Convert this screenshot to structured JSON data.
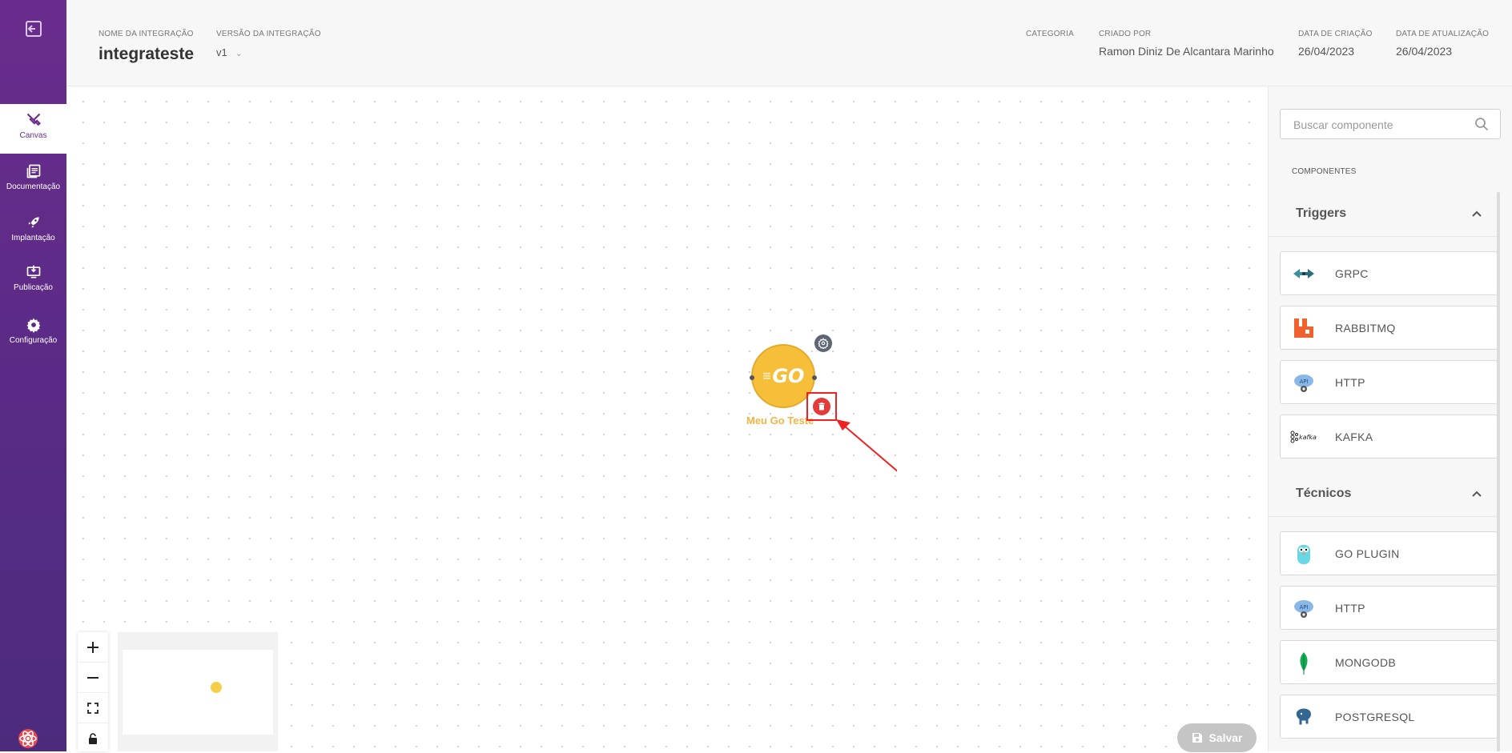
{
  "header": {
    "integration_name_label": "NOME DA INTEGRAÇÃO",
    "integration_name": "integrateste",
    "version_label": "VERSÃO DA INTEGRAÇÃO",
    "version": "v1",
    "category_label": "CATEGORIA",
    "category": "",
    "created_by_label": "CRIADO POR",
    "created_by": "Ramon Diniz De Alcantara Marinho",
    "created_date_label": "DATA DE CRIAÇÃO",
    "created_date": "26/04/2023",
    "updated_date_label": "DATA DE ATUALIZAÇÃO",
    "updated_date": "26/04/2023"
  },
  "sidebar": {
    "items": [
      {
        "label": "Canvas",
        "icon": "tools-icon",
        "active": true
      },
      {
        "label": "Documentação",
        "icon": "document-icon",
        "active": false
      },
      {
        "label": "Implantação",
        "icon": "rocket-icon",
        "active": false
      },
      {
        "label": "Publicação",
        "icon": "publish-icon",
        "active": false
      },
      {
        "label": "Configuração",
        "icon": "gear-icon",
        "active": false
      }
    ]
  },
  "canvas": {
    "node": {
      "label": "Meu Go Teste",
      "logo_text": "GO",
      "color": "#f5bf3a"
    }
  },
  "save_label": "Salvar",
  "panel": {
    "search_placeholder": "Buscar componente",
    "section_label": "COMPONENTES",
    "groups": [
      {
        "title": "Triggers",
        "items": [
          "GRPC",
          "RABBITMQ",
          "HTTP",
          "KAFKA"
        ]
      },
      {
        "title": "Técnicos",
        "items": [
          "GO PLUGIN",
          "HTTP",
          "MONGODB",
          "POSTGRESQL"
        ]
      }
    ]
  },
  "colors": {
    "brand": "#6a2c8c",
    "node": "#f5bf3a",
    "delete": "#e53a3a",
    "highlight": "#ee2222"
  }
}
